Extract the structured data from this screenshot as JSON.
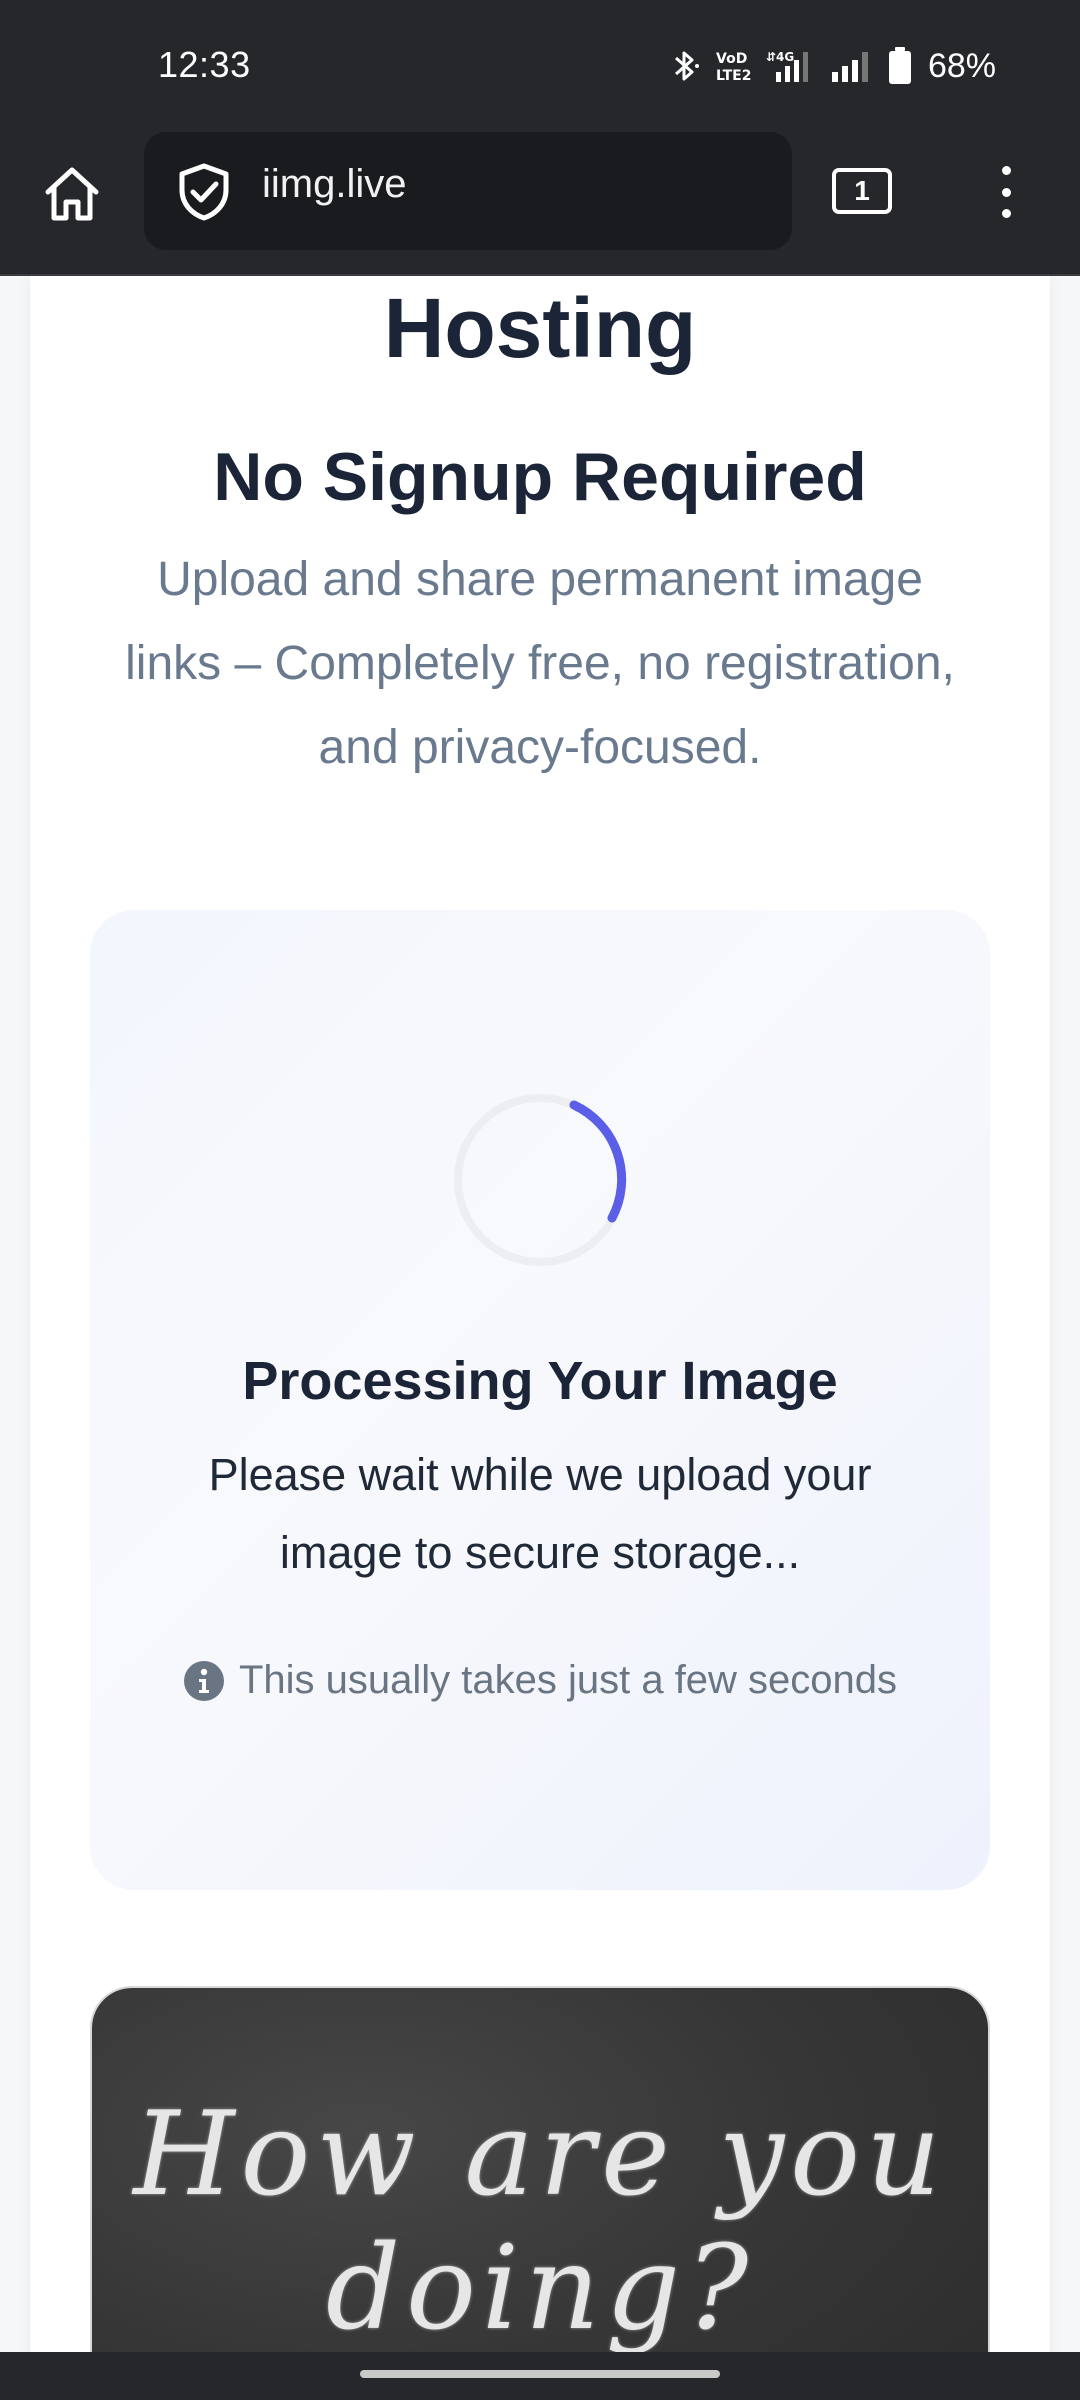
{
  "status_bar": {
    "time": "12:33",
    "battery": "68%",
    "icons": [
      "bluetooth-icon",
      "volte-icon",
      "4g-signal-icon",
      "signal-icon",
      "battery-icon"
    ]
  },
  "browser": {
    "url": "iimg.live",
    "tab_count": "1",
    "icons": [
      "home-icon",
      "shield-check-icon",
      "more-vert-icon"
    ]
  },
  "page": {
    "heading": "Hosting",
    "subheading": "No Signup Required",
    "tagline": "Upload and share permanent image links – Completely free, no registration, and privacy-focused."
  },
  "processing": {
    "title": "Processing Your Image",
    "message": "Please wait while we upload your image to secure storage...",
    "note": "This usually takes just a few seconds",
    "spinner_color": "#5b5ee6"
  },
  "preview": {
    "image_text": "How are you doing?"
  },
  "colors": {
    "chrome": "#26272b",
    "heading": "#1b2537",
    "muted": "#6a7a8e",
    "accent": "#5b5ee6"
  }
}
